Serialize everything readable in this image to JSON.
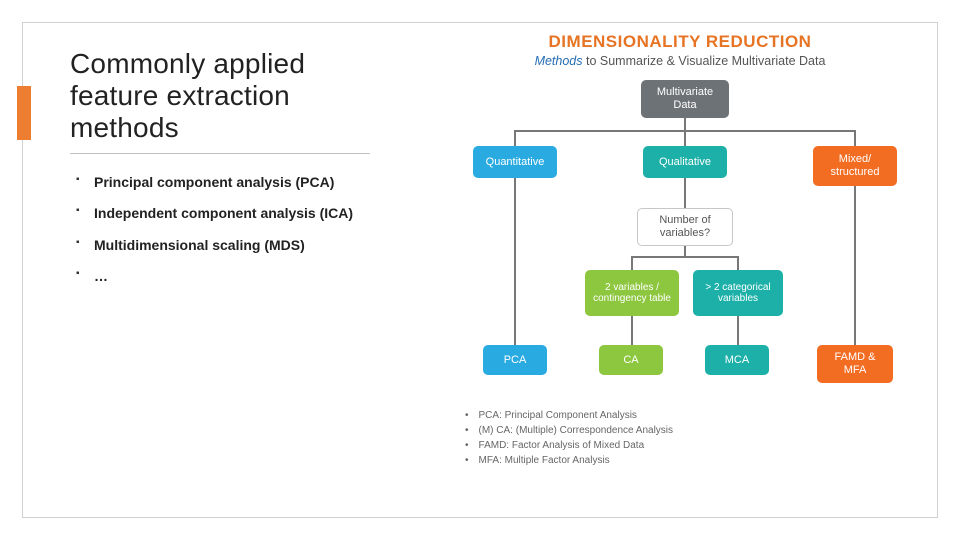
{
  "slide": {
    "title": "Commonly applied feature extraction methods",
    "bullets": [
      "Principal component analysis (PCA)",
      "Independent component analysis (ICA)",
      "Multidimensional scaling (MDS)",
      "…"
    ]
  },
  "diagram": {
    "heading": "DIMENSIONALITY REDUCTION",
    "subheading_prefix": "Methods ",
    "subheading_rest": "to Summarize & Visualize Multivariate Data",
    "root": "Multivariate Data",
    "level1": {
      "quant": "Quantitative",
      "qual": "Qualitative",
      "mixed": "Mixed/ structured"
    },
    "question": "Number of variables?",
    "level2": {
      "two_vars": "2 variables / contingency table",
      "gt2": "> 2 categorical variables"
    },
    "leaves": {
      "pca": "PCA",
      "ca": "CA",
      "mca": "MCA",
      "famd": "FAMD & MFA"
    },
    "legend": [
      "PCA: Principal Component Analysis",
      "(M) CA: (Multiple) Correspondence Analysis",
      "FAMD: Factor Analysis of Mixed Data",
      "MFA: Multiple Factor Analysis"
    ]
  }
}
